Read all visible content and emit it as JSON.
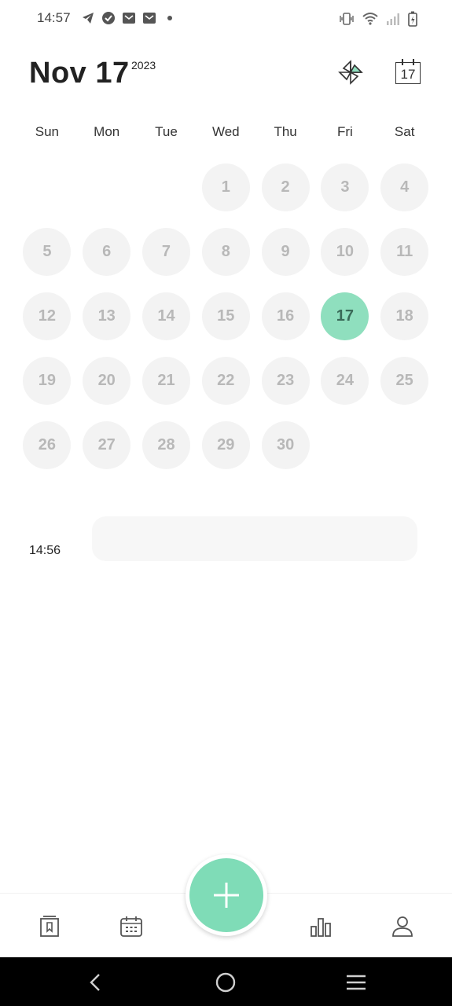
{
  "status_bar": {
    "time": "14:57",
    "left_icons": [
      "telegram-icon",
      "check-circle-icon",
      "mail-icon",
      "mail-icon",
      "dot-icon"
    ],
    "right_icons": [
      "vibrate-icon",
      "wifi-icon",
      "signal-icon",
      "battery-charging-icon"
    ]
  },
  "header": {
    "date": "Nov 17",
    "year": "2023",
    "calendar_icon_day": "17"
  },
  "weekdays": [
    "Sun",
    "Mon",
    "Tue",
    "Wed",
    "Thu",
    "Fri",
    "Sat"
  ],
  "calendar": {
    "first_weekday_index": 3,
    "days": [
      "1",
      "2",
      "3",
      "4",
      "5",
      "6",
      "7",
      "8",
      "9",
      "10",
      "11",
      "12",
      "13",
      "14",
      "15",
      "16",
      "17",
      "18",
      "19",
      "20",
      "21",
      "22",
      "23",
      "24",
      "25",
      "26",
      "27",
      "28",
      "29",
      "30"
    ],
    "selected_day": "17"
  },
  "entry": {
    "time": "14:56"
  },
  "colors": {
    "accent": "#7fdcb7",
    "selected_day_bg": "#8fdfbe",
    "day_bg": "#f3f3f3",
    "day_text": "#b8b8b8"
  },
  "bottom_nav": {
    "items": [
      "journal-icon",
      "calendar-icon",
      "add-icon",
      "stats-icon",
      "profile-icon"
    ]
  },
  "system_nav": {
    "buttons": [
      "back-icon",
      "home-icon",
      "menu-icon"
    ]
  }
}
